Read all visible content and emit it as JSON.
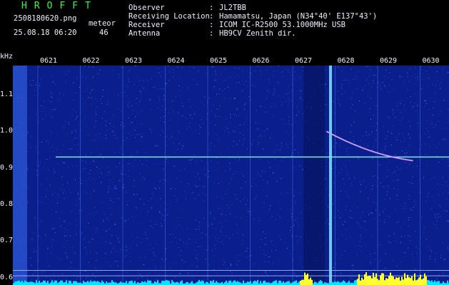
{
  "header": {
    "app_title": "HROFFT",
    "filename": "2508180620.png",
    "datetime": "25.08.18 06:20",
    "kind_label": "meteor",
    "count": "46",
    "fields": [
      {
        "label": "Observer",
        "value": "JL2TBB"
      },
      {
        "label": "Receiving Location",
        "value": "Hamamatsu, Japan (N34°40' E137°43')"
      },
      {
        "label": "Receiver",
        "value": "ICOM IC-R2500 53.1000MHz USB"
      },
      {
        "label": "Antenna",
        "value": "HB9CV Zenith dir."
      }
    ],
    "colon": ":"
  },
  "chart_data": {
    "type": "heatmap",
    "ylabel": "kHz",
    "y_ticks": [
      "1.1",
      "1.0",
      "0.9",
      "0.8",
      "0.7",
      "0.6"
    ],
    "y_tick_values": [
      1.1,
      1.0,
      0.9,
      0.8,
      0.7,
      0.6
    ],
    "ylim": [
      0.58,
      1.18
    ],
    "x_ticks": [
      "0621",
      "0622",
      "0623",
      "0624",
      "0625",
      "0626",
      "0627",
      "0628",
      "0629",
      "0630"
    ],
    "traces": {
      "carrier_khz": 0.93,
      "meteor_head": {
        "start_time": "0628",
        "start_khz": 1.0,
        "end_time": "0630",
        "end_khz": 0.92
      }
    },
    "colors": {
      "background": "#0a1e8c",
      "signal": "#7fe8ff",
      "meteor": "#ff60ff",
      "level_bar": "#00e5ff",
      "level_peak": "#ffff30",
      "text": "#f0f0ff",
      "title": "#22ff44"
    }
  }
}
